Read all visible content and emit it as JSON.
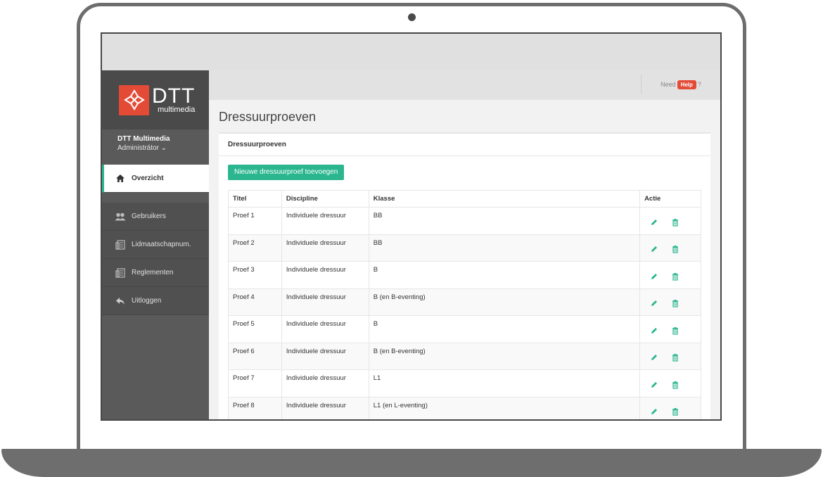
{
  "brand": {
    "logo_main": "DTT",
    "logo_sub": "multimedia",
    "accent": "#2bb68f",
    "logo_color": "#e34b36"
  },
  "user": {
    "name": "DTT Multimedia",
    "role": "Administrátor ⌄"
  },
  "nav": [
    {
      "label": "Overzicht",
      "icon": "home-icon",
      "active": true
    },
    {
      "label": "Gebruikers",
      "icon": "users-icon"
    },
    {
      "label": "Lidmaatschapnum.",
      "icon": "document-icon"
    },
    {
      "label": "Reglementen",
      "icon": "document-icon"
    },
    {
      "label": "Uitloggen",
      "icon": "reply-icon"
    }
  ],
  "topbar": {
    "need": "Need",
    "help": "Help",
    "question": "?"
  },
  "page": {
    "title": "Dressuurproeven",
    "panel_title": "Dressuurproeven",
    "add_button": "Nieuwe dressuurproef toevoegen"
  },
  "table": {
    "headers": [
      "Titel",
      "Discipline",
      "Klasse",
      "Actie"
    ],
    "rows": [
      {
        "titel": "Proef 1",
        "discipline": "Individuele dressuur",
        "klasse": "BB"
      },
      {
        "titel": "Proef 2",
        "discipline": "Individuele dressuur",
        "klasse": "BB"
      },
      {
        "titel": "Proef 3",
        "discipline": "Individuele dressuur",
        "klasse": "B"
      },
      {
        "titel": "Proef 4",
        "discipline": "Individuele dressuur",
        "klasse": "B (en B-eventing)"
      },
      {
        "titel": "Proef 5",
        "discipline": "Individuele dressuur",
        "klasse": "B"
      },
      {
        "titel": "Proef 6",
        "discipline": "Individuele dressuur",
        "klasse": "B (en B-eventing)"
      },
      {
        "titel": "Proef 7",
        "discipline": "Individuele dressuur",
        "klasse": "L1"
      },
      {
        "titel": "Proef 8",
        "discipline": "Individuele dressuur",
        "klasse": "L1 (en L-eventing)"
      }
    ]
  }
}
